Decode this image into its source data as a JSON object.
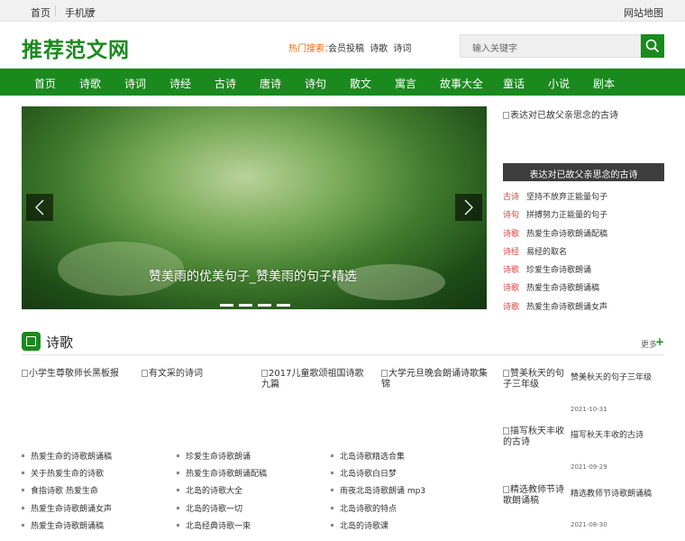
{
  "topbar": {
    "home": "首页",
    "mobile": "手机版",
    "sitemap": "网站地图"
  },
  "header": {
    "logo": "推荐范文网",
    "hot_label": "热门搜索：",
    "hot_links": [
      "会员投稿",
      "诗歌",
      "诗词"
    ],
    "search_placeholder": "输入关键字"
  },
  "nav": [
    "首页",
    "诗歌",
    "诗词",
    "诗经",
    "古诗",
    "唐诗",
    "诗句",
    "散文",
    "寓言",
    "故事大全",
    "童话",
    "小说",
    "剧本"
  ],
  "banner": {
    "caption": "赞美雨的优美句子_赞美雨的句子精选"
  },
  "side": {
    "image_title": "表达对已故父亲思念的古诗",
    "band_title": "表达对已故父亲思念的古诗",
    "items": [
      {
        "cat": "古诗",
        "title": "坚持不放弃正能量句子"
      },
      {
        "cat": "诗句",
        "title": "拼搏努力正能量的句子"
      },
      {
        "cat": "诗歌",
        "title": "热爱生命诗歌朗诵配稿"
      },
      {
        "cat": "诗经",
        "title": "易经的取名"
      },
      {
        "cat": "诗歌",
        "title": "珍爱生命诗歌朗诵"
      },
      {
        "cat": "诗歌",
        "title": "热爱生命诗歌朗诵稿"
      },
      {
        "cat": "诗歌",
        "title": "热爱生命诗歌朗诵女声"
      }
    ]
  },
  "section": {
    "title": "诗歌",
    "more": "更多",
    "pictures": [
      "小学生尊敬师长黑板报",
      "有文采的诗词",
      "2017儿童歌颂祖国诗歌九篇",
      "大学元旦晚会朗诵诗歌集锦"
    ],
    "col1": [
      "热爱生命的诗歌朗诵稿",
      "关于热爱生命的诗歌",
      "食指诗歌 热爱生命",
      "热爱生命诗歌朗诵女声",
      "热爱生命诗歌朗诵稿"
    ],
    "col2": [
      "珍爱生命诗歌朗诵",
      "热爱生命诗歌朗诵配稿",
      "北岛的诗歌大全",
      "北岛的诗歌一切",
      "北岛经典诗歌一束"
    ],
    "col3": [
      "北岛诗歌精选合集",
      "北岛诗歌白日梦",
      "雨夜北岛诗歌朗诵 mp3",
      "北岛诗歌的特点",
      "北岛的诗歌课"
    ],
    "right": [
      {
        "img": "赞美秋天的句子三年级",
        "title": "赞美秋天的句子三年级",
        "date": "2021-10-31"
      },
      {
        "img": "描写秋天丰收的古诗",
        "title": "描写秋天丰收的古诗",
        "date": "2021-09-29"
      },
      {
        "img": "精选教师节诗歌朗诵稿",
        "title": "精选教师节诗歌朗诵稿",
        "date": "2021-08-30"
      }
    ]
  },
  "colors": {
    "brand_green": "#1a8a1e",
    "category_red": "#e03c3c",
    "hot_orange": "#ff6600"
  }
}
